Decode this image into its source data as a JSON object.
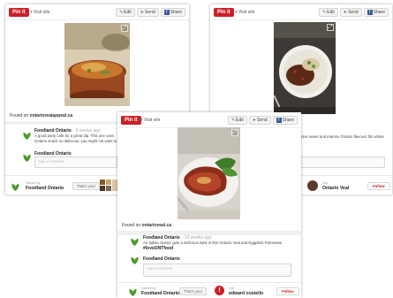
{
  "toolbar": {
    "pinit_label": "Pin it",
    "visit_label": "Visit site",
    "edit_label": "Edit",
    "send_label": "Send",
    "share_label": "Share"
  },
  "card1": {
    "found_prefix": "Found on ",
    "found_domain": "ontariorealappeal.ca",
    "comment": {
      "author": "Foodland Ontario",
      "time": "· 6 weeks ago",
      "text": "A good party cafe for a great dip. This one uses Ontario snack so delicious, you might not want to share!"
    },
    "commenter_name": "Foodland Ontario",
    "comment_placeholder": "Add a comment",
    "saved_by_label": "Saved by",
    "saved_by_name": "Foodland Ontario",
    "thats_you_label": "That's you!"
  },
  "card2": {
    "comment_text_fragment": "ntine sweet and intense Ontario flavours fits whole",
    "via_label": "Via",
    "via_name": "Ontario Veal",
    "follow_label": "Follow"
  },
  "card3": {
    "found_prefix": "Found on ",
    "found_domain": "ontarioveal.ca",
    "comment": {
      "author": "Foodland Ontario",
      "time": "· 13 weeks ago",
      "text": "An Italian classic gets a delicious twist in this Ontario Veal and Eggplant Parmesan",
      "hashtag": "#loveONTfood"
    },
    "commenter_name": "Foodland Ontario",
    "comment_placeholder": "Add a comment",
    "saved_by_label": "Saved by",
    "saved_by_name": "Foodland Ontario",
    "thats_you_label": "That's you!",
    "via_label": "Via",
    "via_name": "edward costello",
    "follow_label": "Follow"
  },
  "colors": {
    "pinterest_red": "#cb2027",
    "facebook_blue": "#3b5998",
    "foodland_green": "#4a9a2e"
  },
  "icons": [
    "heart-icon",
    "pencil-icon",
    "send-arrow-icon",
    "facebook-icon",
    "expand-icon",
    "foodland-leaf-icon",
    "pin-icon"
  ]
}
